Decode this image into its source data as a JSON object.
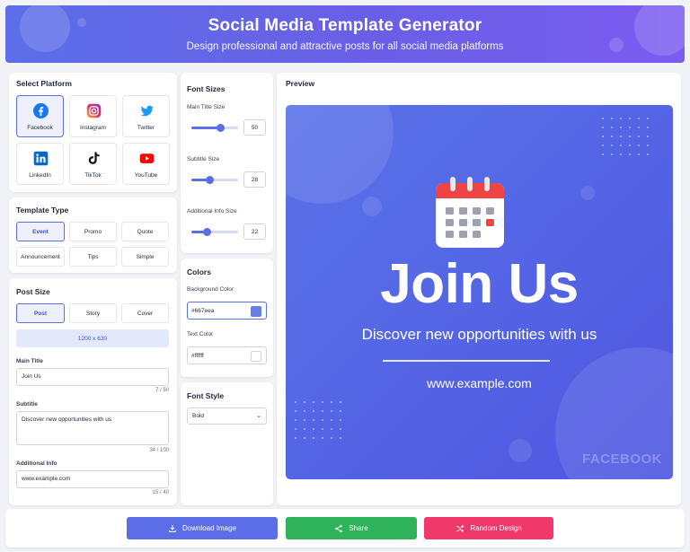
{
  "header": {
    "title": "Social Media Template Generator",
    "subtitle": "Design professional and attractive posts for all social media platforms"
  },
  "platform": {
    "section_title": "Select Platform",
    "items": [
      {
        "label": "Facebook",
        "icon": "facebook-icon",
        "active": true
      },
      {
        "label": "Instagram",
        "icon": "instagram-icon"
      },
      {
        "label": "Twitter",
        "icon": "twitter-icon"
      },
      {
        "label": "LinkedIn",
        "icon": "linkedin-icon"
      },
      {
        "label": "TikTok",
        "icon": "tiktok-icon"
      },
      {
        "label": "YouTube",
        "icon": "youtube-icon"
      }
    ]
  },
  "template_type": {
    "section_title": "Template Type",
    "items": [
      "Event",
      "Promo",
      "Quote",
      "Announcement",
      "Tips",
      "Simple"
    ],
    "active": "Event"
  },
  "post_size": {
    "section_title": "Post Size",
    "items": [
      "Post",
      "Story",
      "Cover"
    ],
    "active": "Post",
    "dimensions": "1200 x 630"
  },
  "fields": {
    "main_title": {
      "label": "Main Title",
      "value": "Join Us",
      "count": "7 / 50"
    },
    "subtitle": {
      "label": "Subtitle",
      "value": "Discover new opportunities with us",
      "count": "34 / 100"
    },
    "additional_info": {
      "label": "Additional Info",
      "value": "www.example.com",
      "count": "15 / 40"
    }
  },
  "font_sizes": {
    "section_title": "Font Sizes",
    "main_title": {
      "label": "Main Title Size",
      "value": "50",
      "fraction": 0.62
    },
    "subtitle": {
      "label": "Subtitle Size",
      "value": "28",
      "fraction": 0.38
    },
    "additional_info": {
      "label": "Additional Info Size",
      "value": "22",
      "fraction": 0.33
    }
  },
  "colors": {
    "section_title": "Colors",
    "background": {
      "label": "Background Color",
      "value": "#667eea"
    },
    "text": {
      "label": "Text Color",
      "value": "#ffffff"
    }
  },
  "font_style": {
    "section_title": "Font Style",
    "value": "Bold"
  },
  "preview": {
    "section_title": "Preview",
    "title": "Join Us",
    "subtitle": "Discover new opportunities with us",
    "info": "www.example.com",
    "watermark": "FACEBOOK",
    "icon": "calendar-icon"
  },
  "actions": {
    "download": "Download Image",
    "share": "Share",
    "random": "Random Design"
  },
  "theme": {
    "accent": "#5b6ee8",
    "download_bg": "#5b6ee8",
    "share_bg": "#2fb35a",
    "random_bg": "#f0386b"
  }
}
